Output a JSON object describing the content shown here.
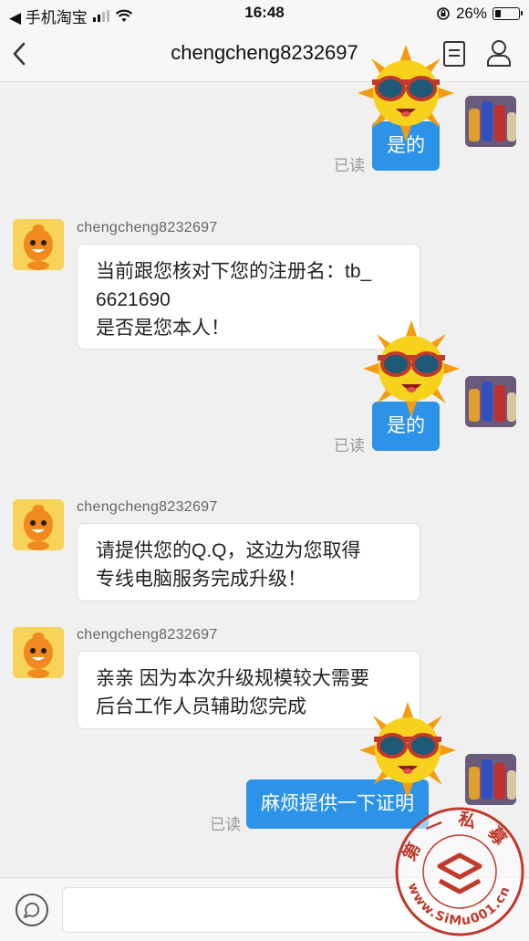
{
  "status_bar": {
    "back_app": "◀ 手机淘宝",
    "time": "16:48",
    "battery": "26%",
    "battery_level": 0.26
  },
  "header": {
    "title": "chengcheng8232697"
  },
  "messages": {
    "m1": {
      "text": "是的",
      "status": "已读"
    },
    "m2": {
      "sender": "chengcheng8232697",
      "text": "当前跟您核对下您的注册名：tb_\n6621690\n是否是您本人！"
    },
    "m3": {
      "text": "是的",
      "status": "已读"
    },
    "m4": {
      "sender": "chengcheng8232697",
      "text": "请提供您的Q.Q，这边为您取得\n专线电脑服务完成升级！"
    },
    "m5": {
      "sender": "chengcheng8232697",
      "text": "亲亲 因为本次升级规模较大需要\n后台工作人员辅助您完成"
    },
    "m6": {
      "text": "麻烦提供一下证明",
      "status": "已读"
    }
  },
  "watermark": {
    "text": "第一私募",
    "url": "www.SiMu001.cn"
  },
  "colors": {
    "accent": "#2d93e8",
    "background": "#f0f0f0",
    "watermark": "#c0392b"
  },
  "icons": {
    "back": "chevron-left-icon",
    "doc": "document-icon",
    "user": "user-icon",
    "voice": "voice-icon"
  }
}
